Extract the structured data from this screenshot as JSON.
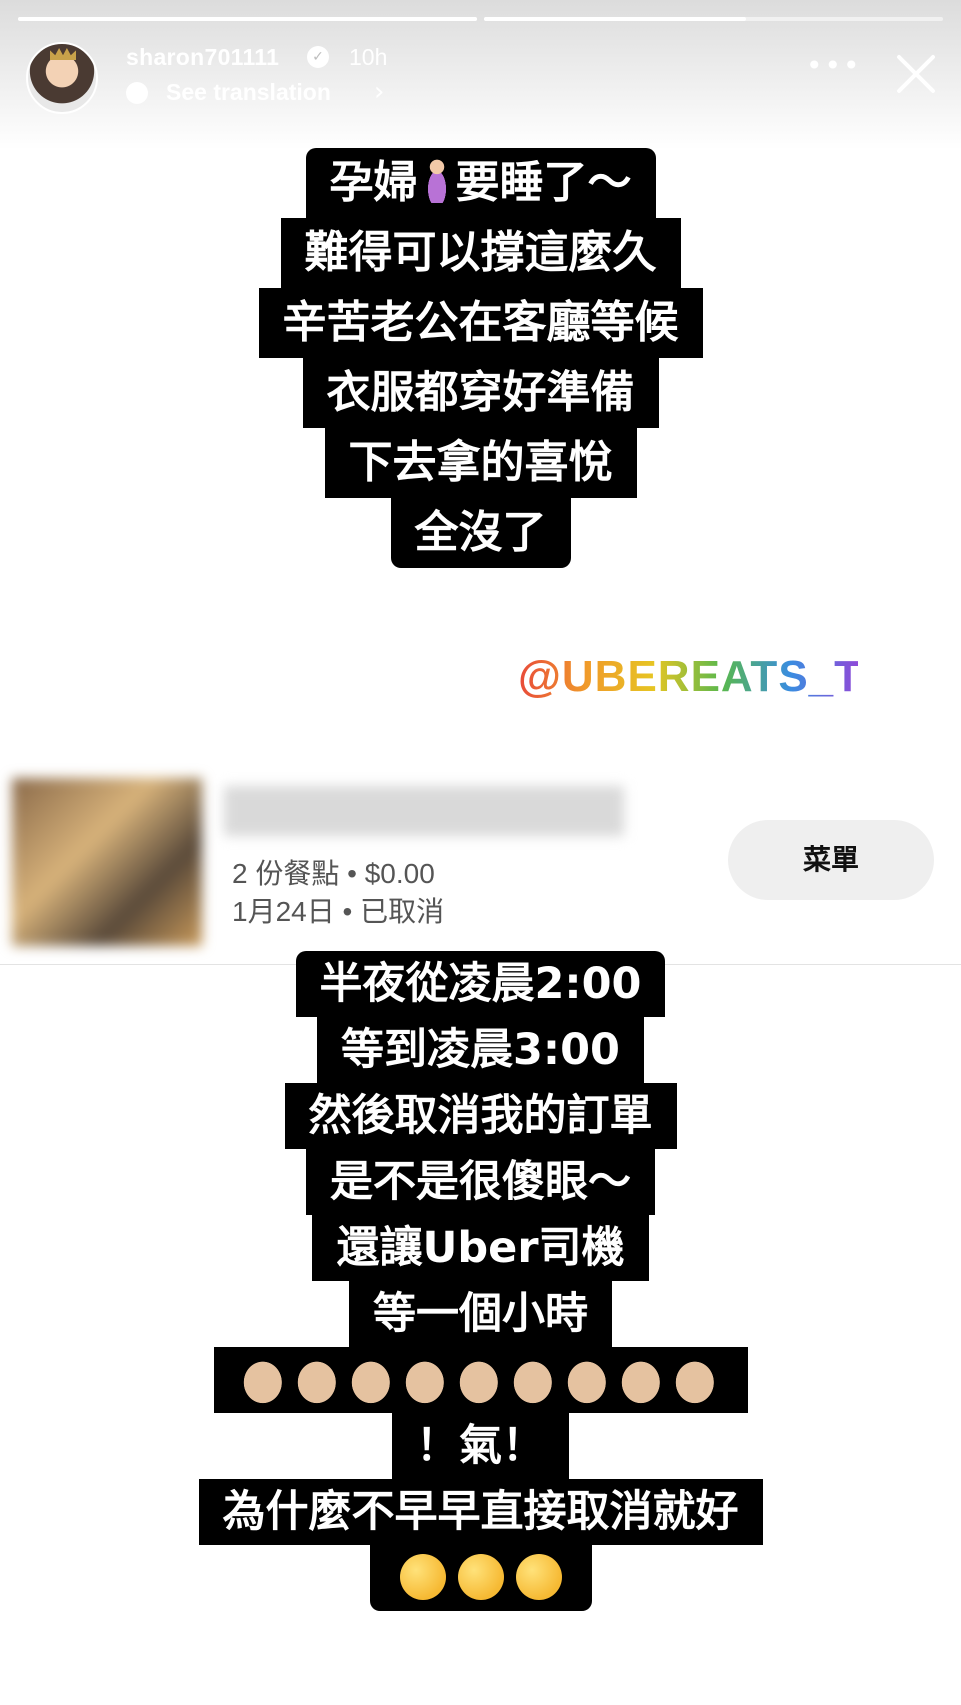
{
  "story": {
    "username": "sharon701111",
    "time_ago": "10h",
    "see_translation": "See translation",
    "progress_bars": [
      {
        "fill_fraction": 1.0
      },
      {
        "fill_fraction": 0.57
      }
    ]
  },
  "caption_top": {
    "line1_a": "孕婦",
    "line1_b": "要睡了～",
    "lines": [
      "難得可以撐這麼久",
      "辛苦老公在客廳等候",
      "衣服都穿好準備",
      "下去拿的喜悅",
      "全沒了"
    ]
  },
  "mention": "@UBEREATS_TW",
  "order": {
    "items_price": "2 份餐點 • $0.00",
    "date_status": "1月24日 • 已取消",
    "menu_button": "菜單"
  },
  "caption_bottom": {
    "lines_before": [
      "半夜從凌晨2:00",
      "等到凌晨3:00",
      "然後取消我的訂單",
      "是不是很傻眼～",
      "還讓Uber司機",
      "等一個小時"
    ],
    "thumbs_down_count": 9,
    "line_angry": "！氣！",
    "line_why": "為什麼不早早直接取消就好",
    "eye_roll_count": 3
  },
  "icons": {
    "verified": "verified-badge-icon",
    "translate": "speech-bubble-icon",
    "more": "more-horizontal-icon",
    "close": "close-icon",
    "thumbs_down": "thumbs-down-emoji",
    "eye_roll": "face-with-rolling-eyes-emoji",
    "pregnant": "pregnant-woman-emoji"
  }
}
